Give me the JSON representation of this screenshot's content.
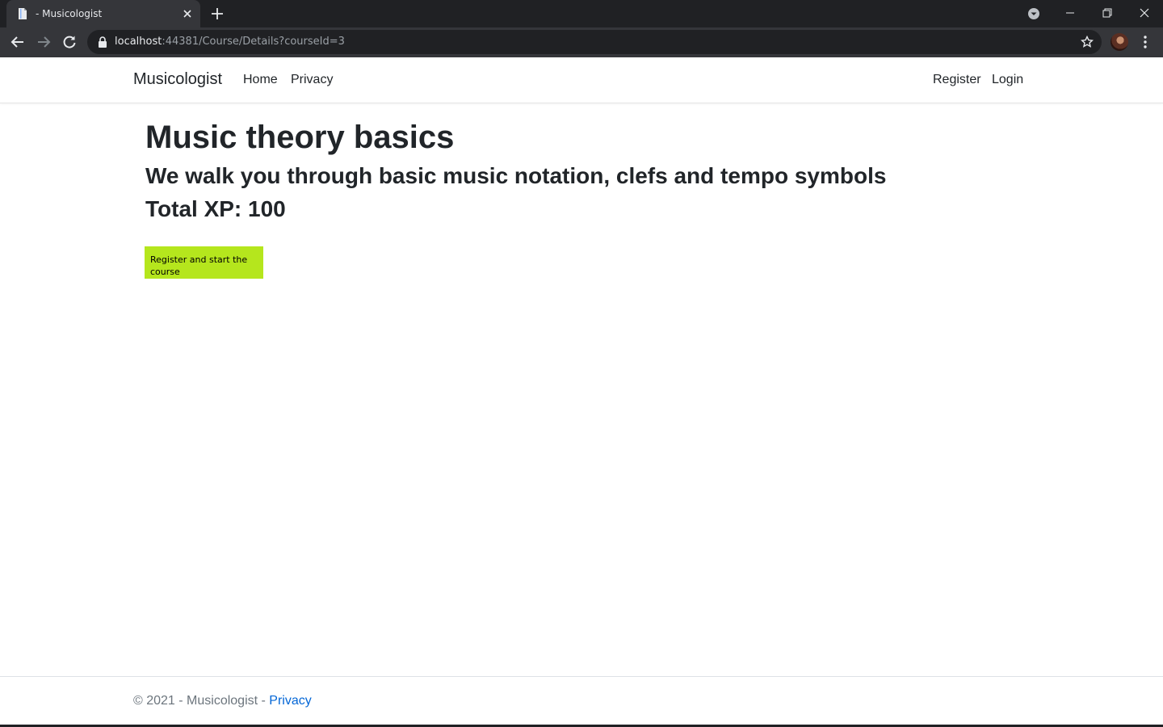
{
  "browser": {
    "tab_title": "- Musicologist",
    "url_host": "localhost",
    "url_rest": ":44381/Course/Details?courseId=3",
    "colors": {
      "frame": "#202124",
      "toolbar": "#35363a",
      "text": "#e8eaed"
    }
  },
  "navbar": {
    "brand": "Musicologist",
    "left_links": [
      "Home",
      "Privacy"
    ],
    "right_links": [
      "Register",
      "Login"
    ]
  },
  "course": {
    "title": "Music theory basics",
    "description": "We walk you through basic music notation, clefs and tempo symbols",
    "xp_text": "Total XP: 100",
    "start_button_label": "Register and start the course",
    "button_color": "#b5e61d"
  },
  "footer": {
    "copyright": "© 2021 - Musicologist - ",
    "privacy_link": "Privacy",
    "link_color": "#0366d6"
  }
}
